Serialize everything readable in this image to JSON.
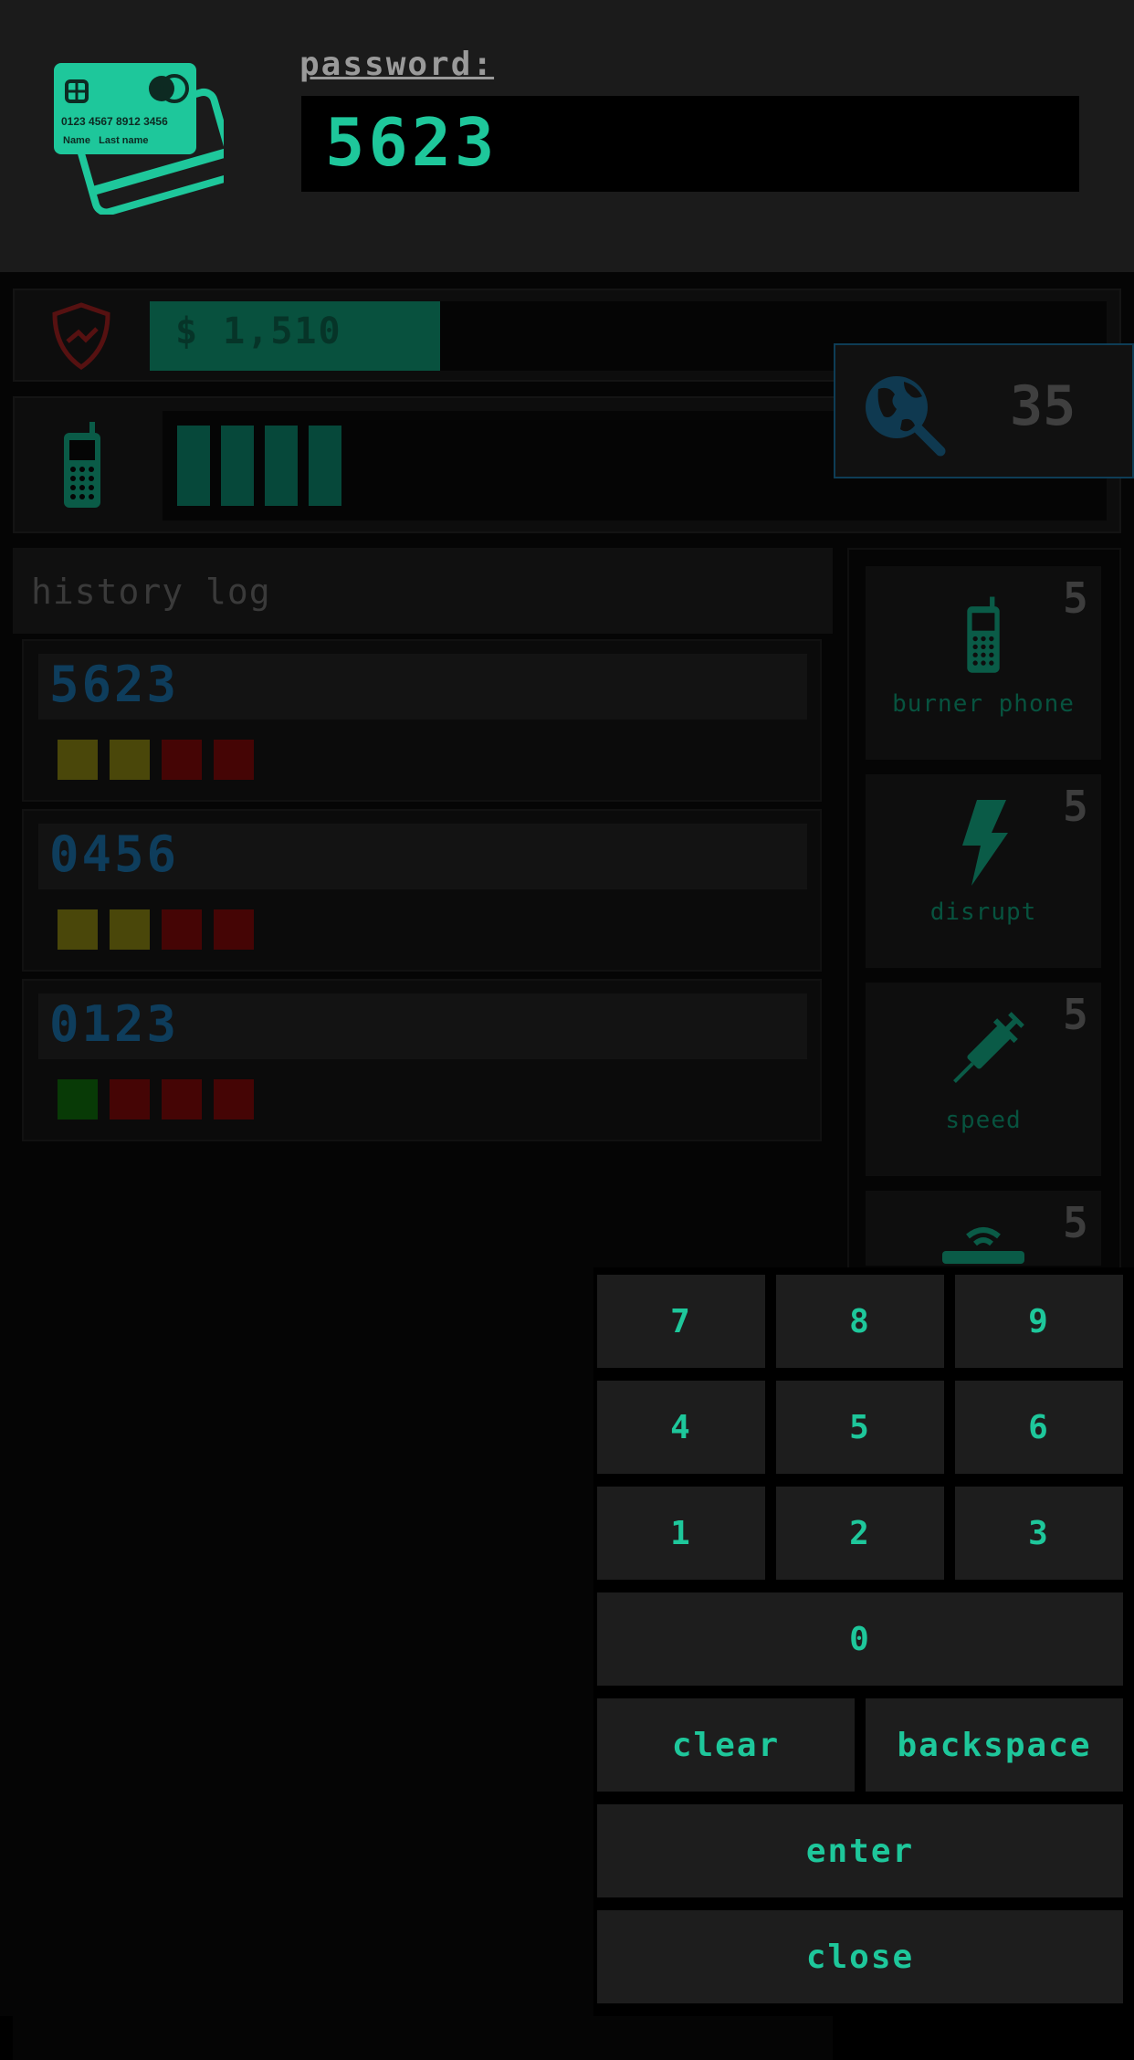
{
  "header": {
    "password_label": "password:",
    "password_value": "5623",
    "card": {
      "number": "0123  4567  8912  3456",
      "name": "Name   Last name"
    }
  },
  "money": {
    "text": "$ 1,510",
    "fill_fraction": 0.3
  },
  "signal": {
    "bars": 4
  },
  "scan": {
    "count": "35"
  },
  "history": {
    "title": "history log",
    "entries": [
      {
        "code": "5623",
        "feedback": [
          "yellow",
          "yellow",
          "red",
          "red"
        ]
      },
      {
        "code": "0456",
        "feedback": [
          "yellow",
          "yellow",
          "red",
          "red"
        ]
      },
      {
        "code": "0123",
        "feedback": [
          "green",
          "red",
          "red",
          "red"
        ]
      }
    ]
  },
  "shop": {
    "items": [
      {
        "label": "burner phone",
        "cost": "5",
        "icon": "phone-icon"
      },
      {
        "label": "disrupt",
        "cost": "5",
        "icon": "lightning-icon"
      },
      {
        "label": "speed",
        "cost": "5",
        "icon": "syringe-icon"
      },
      {
        "label": "",
        "cost": "5",
        "icon": "router-icon"
      }
    ]
  },
  "keypad": {
    "k7": "7",
    "k8": "8",
    "k9": "9",
    "k4": "4",
    "k5": "5",
    "k6": "6",
    "k1": "1",
    "k2": "2",
    "k3": "3",
    "k0": "0",
    "clear": "clear",
    "backspace": "backspace",
    "enter": "enter",
    "close": "close"
  },
  "colors": {
    "accent": "#1ec79b",
    "header_bg": "#1b1b1b",
    "key_bg": "#1d1d1d",
    "feedback_yellow": "#4a470a",
    "feedback_red": "#450505",
    "feedback_green": "#083a06",
    "code_blue": "#0e3d5c"
  }
}
